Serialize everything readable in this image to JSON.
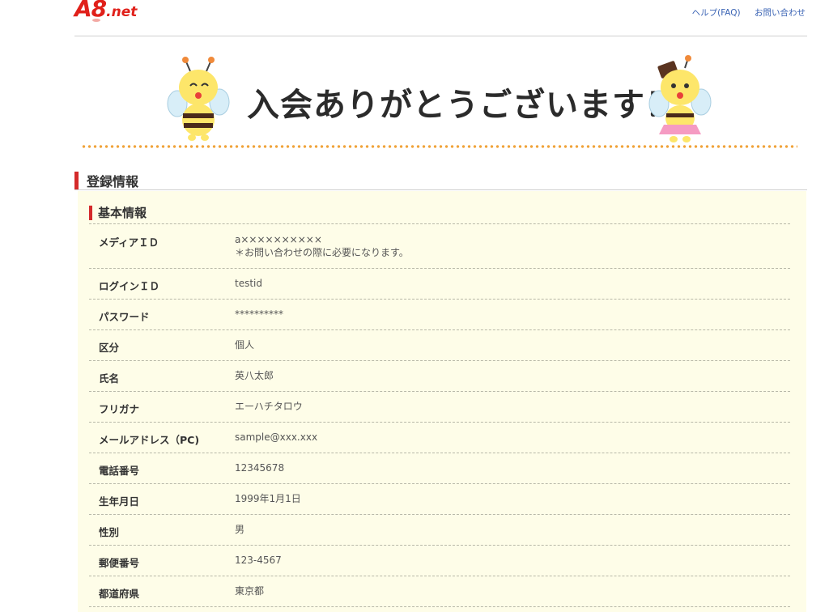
{
  "header": {
    "logo_main": "A8",
    "logo_suffix": ".net",
    "links": [
      "ヘルプ(FAQ)",
      "お問い合わせ"
    ]
  },
  "banner": {
    "title": "入会ありがとうございます！"
  },
  "section": {
    "title": "登録情報"
  },
  "panel": {
    "title": "基本情報",
    "rows": [
      {
        "label": "メディアＩＤ",
        "value": "a××××××××××",
        "note": "＊お問い合わせの際に必要になります。"
      },
      {
        "label": "ログインＩＤ",
        "value": "testid"
      },
      {
        "label": "パスワード",
        "value": "**********"
      },
      {
        "label": "区分",
        "value": "個人"
      },
      {
        "label": "氏名",
        "value": "英八太郎"
      },
      {
        "label": "フリガナ",
        "value": "エーハチタロウ"
      },
      {
        "label": "メールアドレス（PC)",
        "value": "sample@xxx.xxx"
      },
      {
        "label": "電話番号",
        "value": "12345678"
      },
      {
        "label": "生年月日",
        "value": "1999年1月1日"
      },
      {
        "label": "性別",
        "value": "男"
      },
      {
        "label": "郵便番号",
        "value": "123-4567"
      },
      {
        "label": "都道府県",
        "value": "東京都"
      }
    ]
  },
  "colors": {
    "accent_red": "#d42a2a",
    "panel_bg": "#fefde8",
    "link_blue": "#3a63b4",
    "dot_orange": "#f0a33b"
  },
  "icons": [
    "bee-mascot-left",
    "bee-mascot-right"
  ]
}
